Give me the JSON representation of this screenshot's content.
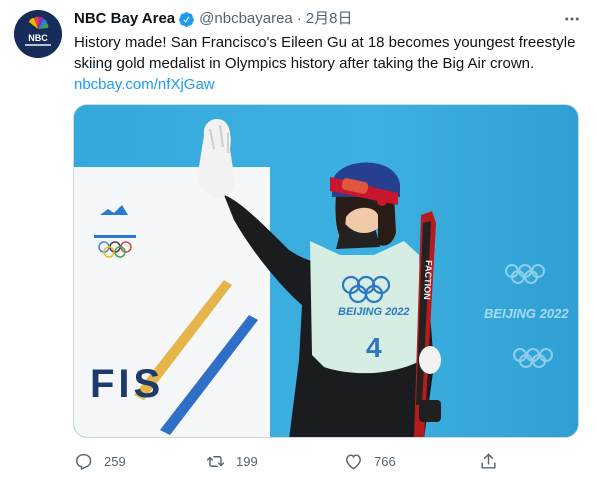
{
  "tweet": {
    "avatar_text": "NBC",
    "display_name": "NBC Bay Area",
    "handle": "@nbcbayarea",
    "separator": "·",
    "date": "2月8日",
    "text": "History made! San Francisco's Eileen Gu at 18 becomes youngest freestyle skiing gold medalist in Olympics history after taking the Big Air crown.",
    "link": "nbcbay.com/nfXjGaw",
    "media": {
      "banner_text": "BEIJING 2022",
      "bib_text": "BEIJING 2022",
      "bib_number": "4",
      "ski_text": "FACTION",
      "fis_text": "FIS"
    },
    "actions": {
      "reply_count": "259",
      "retweet_count": "199",
      "like_count": "766"
    }
  },
  "colors": {
    "link": "#1d9bf0",
    "muted": "#536471",
    "verified": "#1d9bf0",
    "avatar_bg": "#162c5a",
    "media_bg": "#29a8d9"
  },
  "icons": [
    "verified-badge-icon",
    "more-options-icon",
    "reply-icon",
    "retweet-icon",
    "like-icon",
    "share-icon"
  ]
}
